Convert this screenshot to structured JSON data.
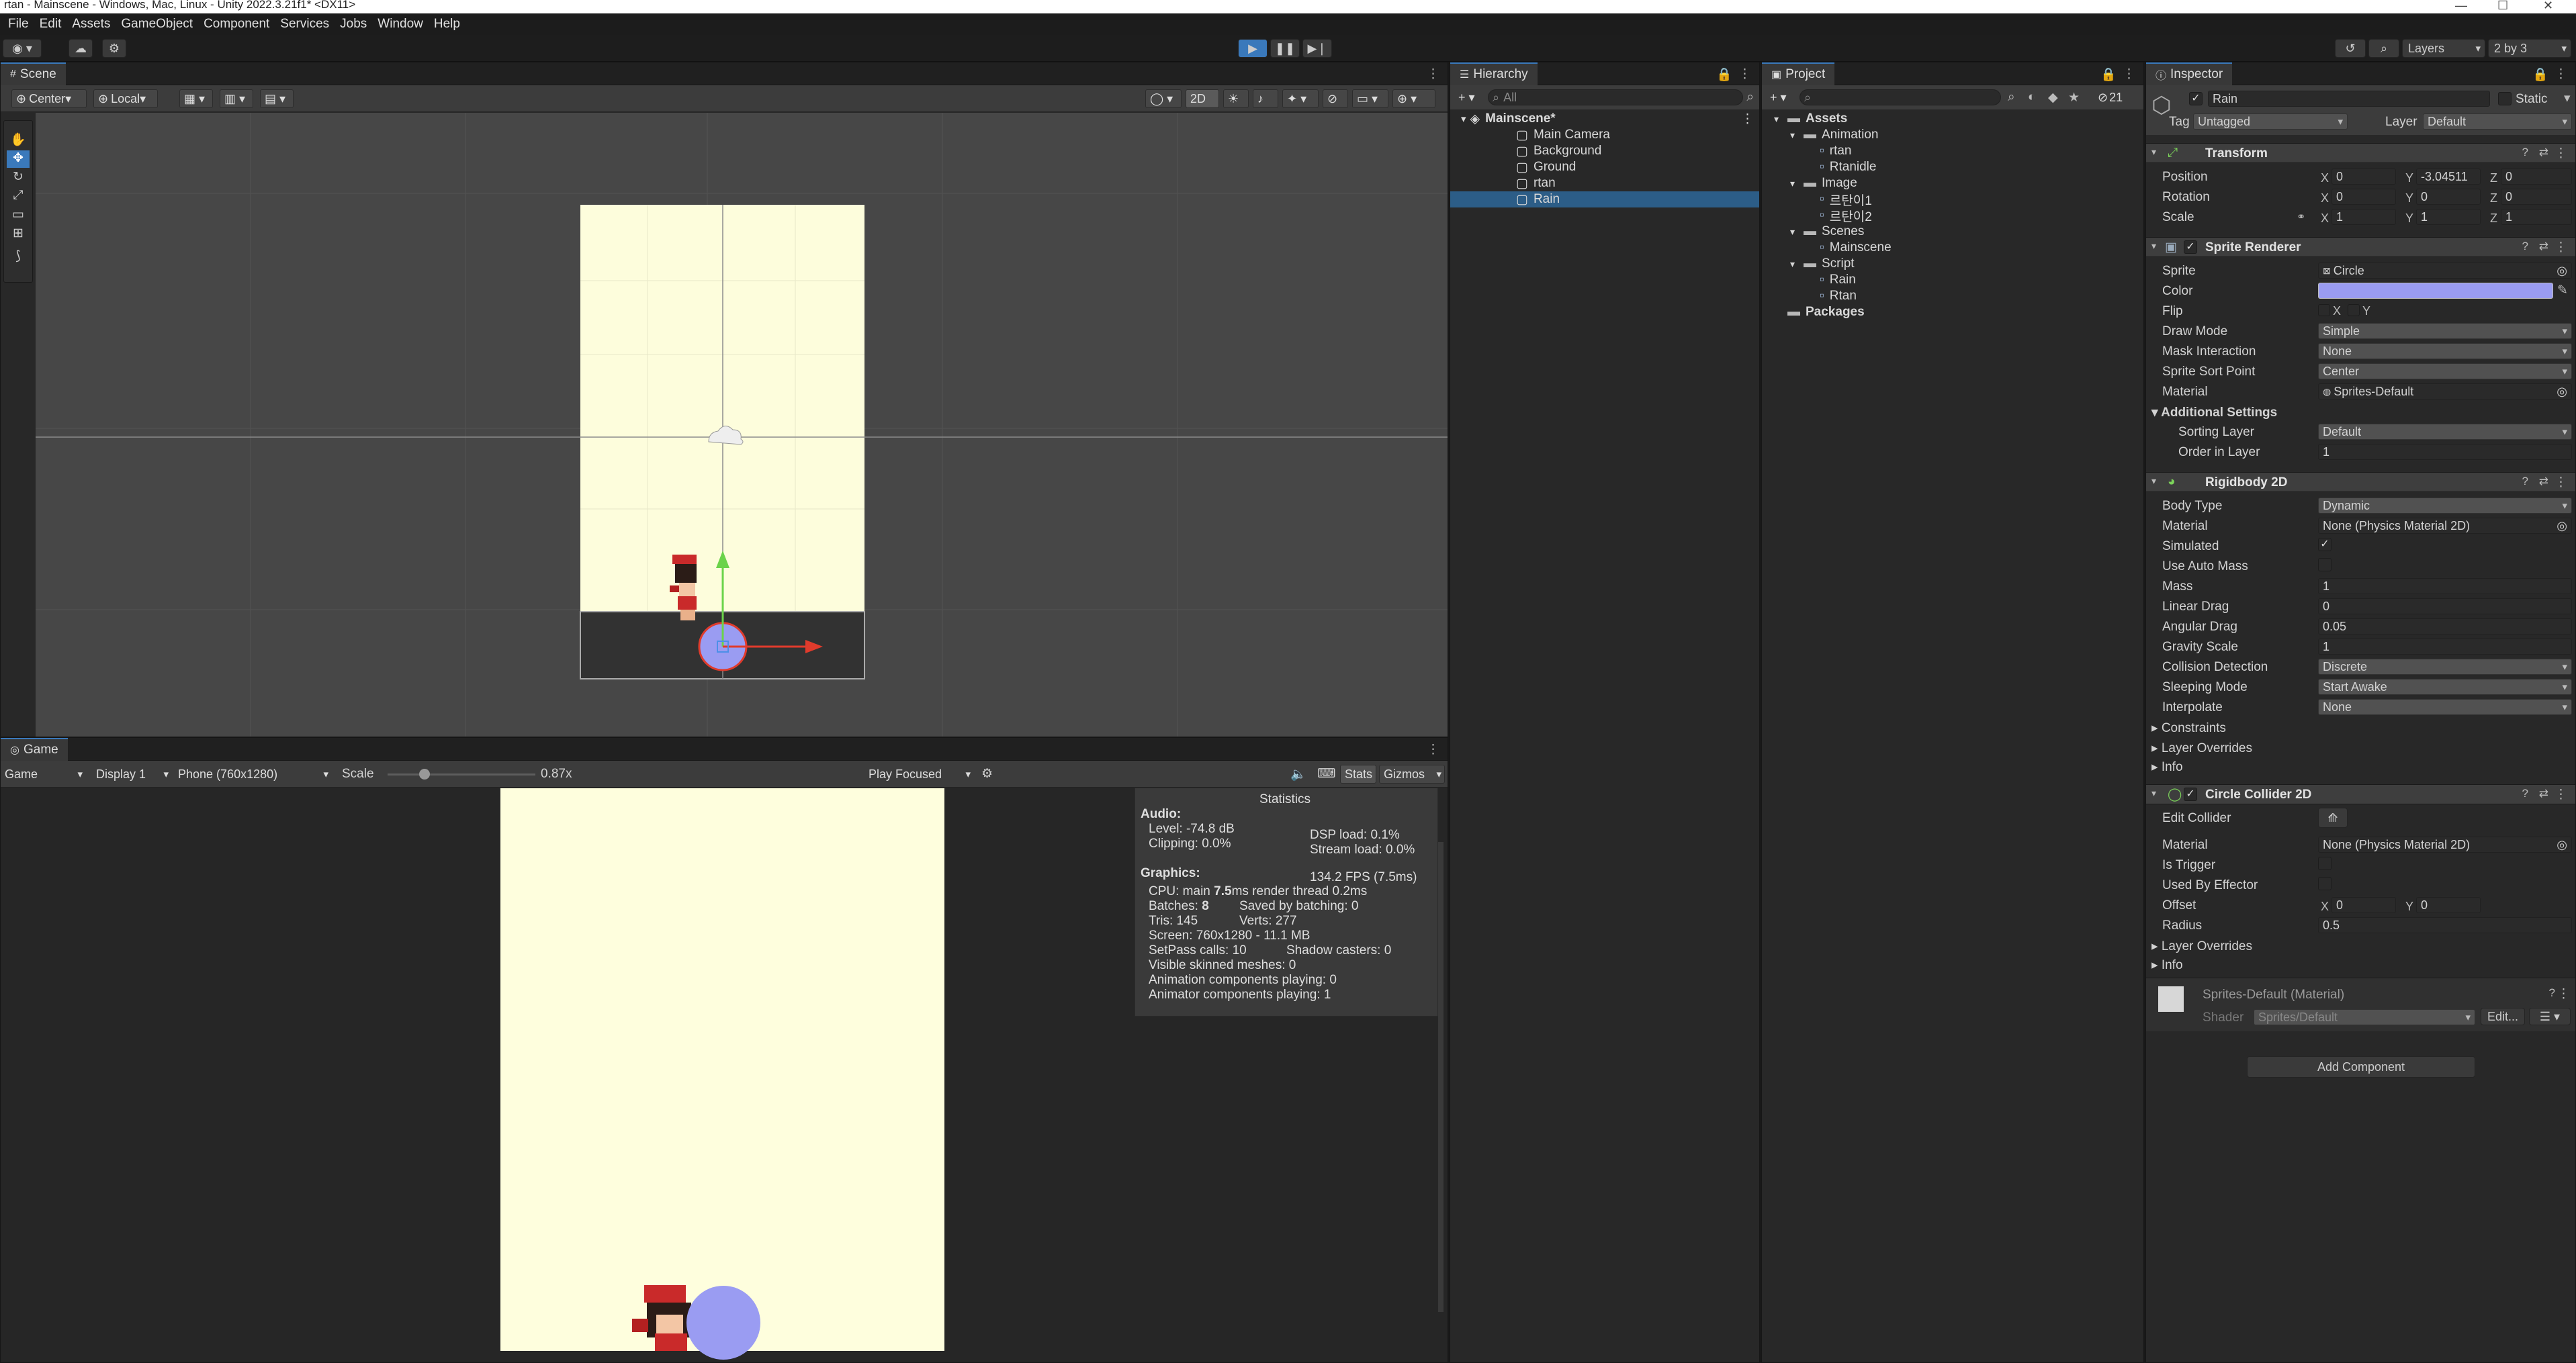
{
  "window_title": "rtan - Mainscene - Windows, Mac, Linux - Unity 2022.3.21f1* <DX11>",
  "menu": [
    "File",
    "Edit",
    "Assets",
    "GameObject",
    "Component",
    "Services",
    "Jobs",
    "Window",
    "Help"
  ],
  "toolbar": {
    "layers": "Layers",
    "layout": "2 by 3"
  },
  "scene": {
    "tab": "Scene",
    "pivot": "Center",
    "space": "Local",
    "mode2d": "2D"
  },
  "game": {
    "tab": "Game",
    "view": "Game",
    "display": "Display 1",
    "resolution": "Phone (760x1280)",
    "scale_label": "Scale",
    "scale_value": "0.87x",
    "scale_fraction": 0.25,
    "play_focused": "Play Focused",
    "stats": "Stats",
    "gizmos": "Gizmos"
  },
  "statistics": {
    "title": "Statistics",
    "audio": "Audio:",
    "level": "Level: -74.8 dB",
    "clipping": "Clipping: 0.0%",
    "dsp": "DSP load: 0.1%",
    "stream": "Stream load: 0.0%",
    "graphics": "Graphics:",
    "fps": "134.2 FPS (7.5ms)",
    "cpu_a": "CPU: main ",
    "cpu_b": "7.5",
    "cpu_c": "ms  render thread 0.2ms",
    "batches_a": "Batches: ",
    "batches_b": "8",
    "saved": "Saved by batching: 0",
    "tris": "Tris: 145",
    "verts": "Verts: 277",
    "screen": "Screen: 760x1280 - 11.1 MB",
    "setpass": "SetPass calls: 10",
    "shadow": "Shadow casters: 0",
    "skinned": "Visible skinned meshes: 0",
    "anim": "Animation components playing: 0",
    "animator": "Animator components playing: 1"
  },
  "hierarchy": {
    "tab": "Hierarchy",
    "search": "All",
    "scene": "Mainscene*",
    "items": [
      "Main Camera",
      "Background",
      "Ground",
      "rtan",
      "Rain"
    ]
  },
  "project": {
    "tab": "Project",
    "badge": "21",
    "tree": [
      {
        "label": "Assets",
        "depth": 0,
        "bold": true
      },
      {
        "label": "Animation",
        "depth": 1
      },
      {
        "label": "rtan",
        "depth": 2
      },
      {
        "label": "Rtanidle",
        "depth": 2
      },
      {
        "label": "Image",
        "depth": 1
      },
      {
        "label": "르탄이1",
        "depth": 2
      },
      {
        "label": "르탄이2",
        "depth": 2
      },
      {
        "label": "Scenes",
        "depth": 1
      },
      {
        "label": "Mainscene",
        "depth": 2
      },
      {
        "label": "Script",
        "depth": 1
      },
      {
        "label": "Rain",
        "depth": 2
      },
      {
        "label": "Rtan",
        "depth": 2
      },
      {
        "label": "Packages",
        "depth": 0,
        "bold": true
      }
    ]
  },
  "inspector": {
    "tab": "Inspector",
    "name": "Rain",
    "static": "Static",
    "tag_label": "Tag",
    "tag": "Untagged",
    "layer_label": "Layer",
    "layer": "Default",
    "transform": {
      "title": "Transform",
      "position": {
        "label": "Position",
        "x": "0",
        "y": "-3.04511",
        "z": "0"
      },
      "rotation": {
        "label": "Rotation",
        "x": "0",
        "y": "0",
        "z": "0"
      },
      "scale": {
        "label": "Scale",
        "x": "1",
        "y": "1",
        "z": "1"
      }
    },
    "sprite_renderer": {
      "title": "Sprite Renderer",
      "sprite_label": "Sprite",
      "sprite": "Circle",
      "color_label": "Color",
      "color": "#9a9cf2",
      "flip_label": "Flip",
      "flip_x": "X",
      "flip_y": "Y",
      "draw_mode_label": "Draw Mode",
      "draw_mode": "Simple",
      "mask_label": "Mask Interaction",
      "mask": "None",
      "sort_point_label": "Sprite Sort Point",
      "sort_point": "Center",
      "material_label": "Material",
      "material": "Sprites-Default",
      "additional": "Additional Settings",
      "sorting_layer_label": "Sorting Layer",
      "sorting_layer": "Default",
      "order_label": "Order in Layer",
      "order": "1"
    },
    "rigidbody": {
      "title": "Rigidbody 2D",
      "body_type_label": "Body Type",
      "body_type": "Dynamic",
      "material_label": "Material",
      "material": "None (Physics Material 2D)",
      "simulated_label": "Simulated",
      "auto_mass_label": "Use Auto Mass",
      "mass_label": "Mass",
      "mass": "1",
      "linear_drag_label": "Linear Drag",
      "linear_drag": "0",
      "angular_drag_label": "Angular Drag",
      "angular_drag": "0.05",
      "gravity_label": "Gravity Scale",
      "gravity": "1",
      "collision_label": "Collision Detection",
      "collision": "Discrete",
      "sleeping_label": "Sleeping Mode",
      "sleeping": "Start Awake",
      "interpolate_label": "Interpolate",
      "interpolate": "None",
      "constraints": "Constraints",
      "layer_overrides": "Layer Overrides",
      "info": "Info"
    },
    "collider": {
      "title": "Circle Collider 2D",
      "edit_label": "Edit Collider",
      "material_label": "Material",
      "material": "None (Physics Material 2D)",
      "trigger_label": "Is Trigger",
      "effector_label": "Used By Effector",
      "offset_label": "Offset",
      "offset_x": "0",
      "offset_y": "0",
      "radius_label": "Radius",
      "radius": "0.5",
      "layer_overrides": "Layer Overrides",
      "info": "Info"
    },
    "material_asset": {
      "name": "Sprites-Default (Material)",
      "shader_label": "Shader",
      "shader": "Sprites/Default",
      "edit": "Edit..."
    },
    "add_component": "Add Component"
  }
}
